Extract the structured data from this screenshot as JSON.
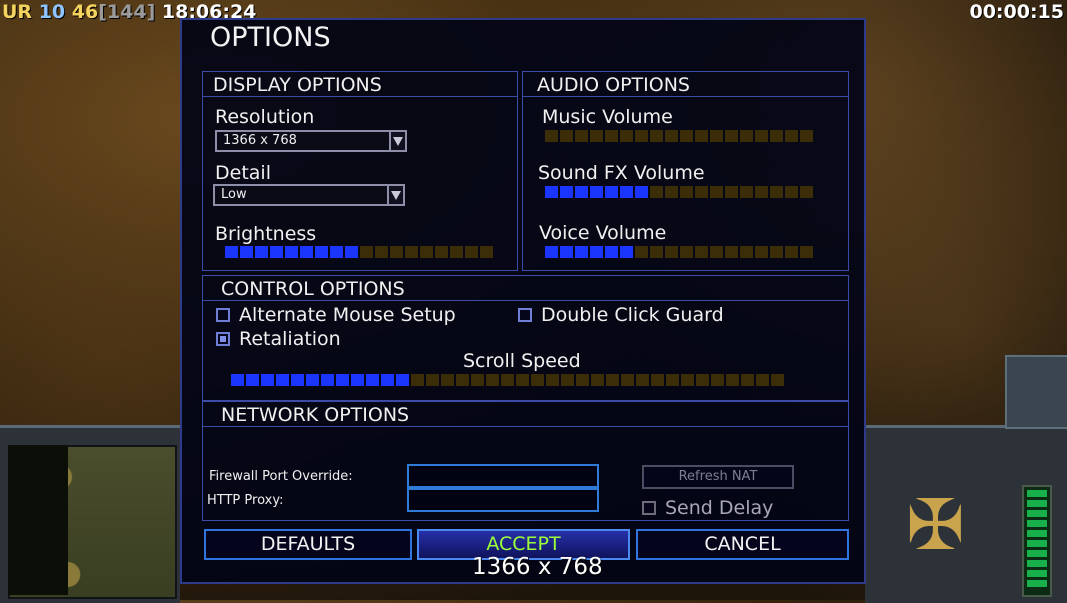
{
  "hud": {
    "faction": "UR",
    "stat1": "10",
    "stat2": "46",
    "stat3": "[144]",
    "clock": "18:06:24",
    "timer": "00:00:15"
  },
  "dialog": {
    "title": "OPTIONS",
    "display": {
      "header": "DISPLAY OPTIONS",
      "resolution_label": "Resolution",
      "resolution_value": "1366 x 768",
      "detail_label": "Detail",
      "detail_value": "Low",
      "brightness_label": "Brightness",
      "brightness_level": 9,
      "brightness_segments": 18
    },
    "audio": {
      "header": "AUDIO OPTIONS",
      "music_label": "Music Volume",
      "music_level": 0,
      "sfx_label": "Sound FX Volume",
      "sfx_level": 7,
      "voice_label": "Voice Volume",
      "voice_level": 6,
      "segments": 18
    },
    "control": {
      "header": "CONTROL OPTIONS",
      "alt_mouse_label": "Alternate Mouse Setup",
      "alt_mouse_checked": false,
      "double_click_label": "Double Click Guard",
      "double_click_checked": false,
      "retaliation_label": "Retaliation",
      "retaliation_checked": true,
      "scroll_speed_label": "Scroll Speed",
      "scroll_speed_level": 12,
      "scroll_speed_segments": 37
    },
    "network": {
      "header": "NETWORK OPTIONS",
      "firewall_label": "Firewall Port Override:",
      "firewall_value": "",
      "proxy_label": "HTTP Proxy:",
      "proxy_value": "",
      "refresh_nat_label": "Refresh NAT",
      "send_delay_label": "Send Delay",
      "send_delay_checked": false
    },
    "buttons": {
      "defaults": "DEFAULTS",
      "accept": "ACCEPT",
      "cancel": "CANCEL"
    },
    "resolution_readout": "1366 x 768"
  },
  "colors": {
    "accent": "#2f74e0",
    "slider_on": "#1b35ff",
    "slider_off": "#3a2d08",
    "accept_text": "#9cff3a"
  }
}
